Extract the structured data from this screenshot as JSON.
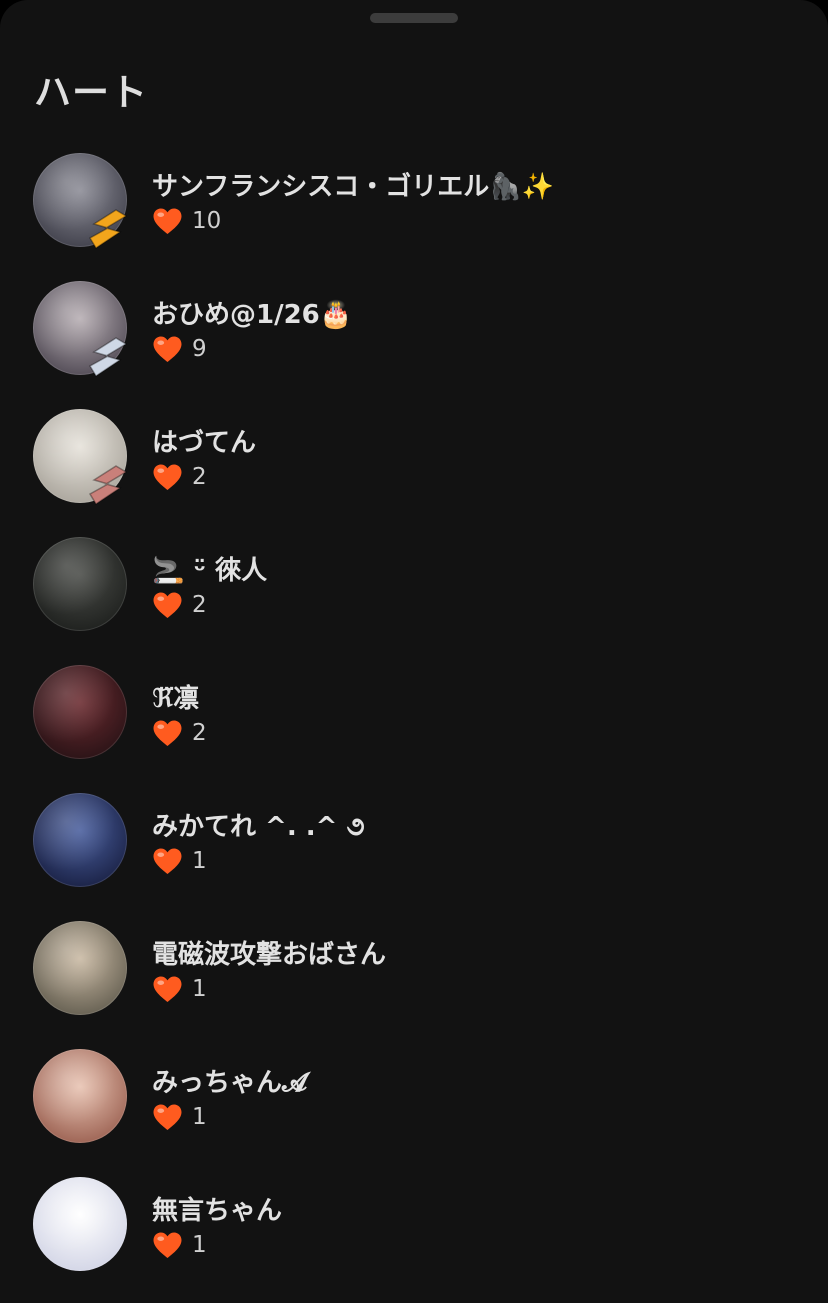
{
  "sheet": {
    "title": "ハート"
  },
  "likers": [
    {
      "name": "サンフランシスコ・ゴリエル🦍✨",
      "hearts": "10",
      "avatar": [
        "#8c8c96",
        "#2f2f3a"
      ],
      "badge_color": "#f2a51c"
    },
    {
      "name": "おひめ@1/26🎂",
      "hearts": "9",
      "avatar": [
        "#b7aeb3",
        "#3a3440"
      ],
      "badge_color": "#cfd8e6"
    },
    {
      "name": "はづてん",
      "hearts": "2",
      "avatar": [
        "#e6e2da",
        "#9c978e"
      ],
      "badge_color": "#c9807a"
    },
    {
      "name": "🚬 ᵕ̈ 徠人",
      "hearts": "2",
      "avatar": [
        "#4a4c48",
        "#141614"
      ],
      "badge_color": ""
    },
    {
      "name": "ℜ⃛凛",
      "hearts": "2",
      "avatar": [
        "#6b2b30",
        "#1a0d10"
      ],
      "badge_color": ""
    },
    {
      "name": "みかてれ ^. .^ ૭",
      "hearts": "1",
      "avatar": [
        "#4a5f9e",
        "#0f1330"
      ],
      "badge_color": ""
    },
    {
      "name": "電磁波攻撃おばさん",
      "hearts": "1",
      "avatar": [
        "#c9b9a3",
        "#4d4a3e"
      ],
      "badge_color": ""
    },
    {
      "name": "みっちゃん𝓐",
      "hearts": "1",
      "avatar": [
        "#e8c3b2",
        "#8a4b3c"
      ],
      "badge_color": ""
    },
    {
      "name": "無言ちゃん",
      "hearts": "1",
      "avatar": [
        "#ffffff",
        "#c8cbe0"
      ],
      "badge_color": ""
    }
  ],
  "heart_color": "#ff5b1f",
  "icons": {
    "heart": "heart-icon",
    "badge": "badge-icon"
  }
}
